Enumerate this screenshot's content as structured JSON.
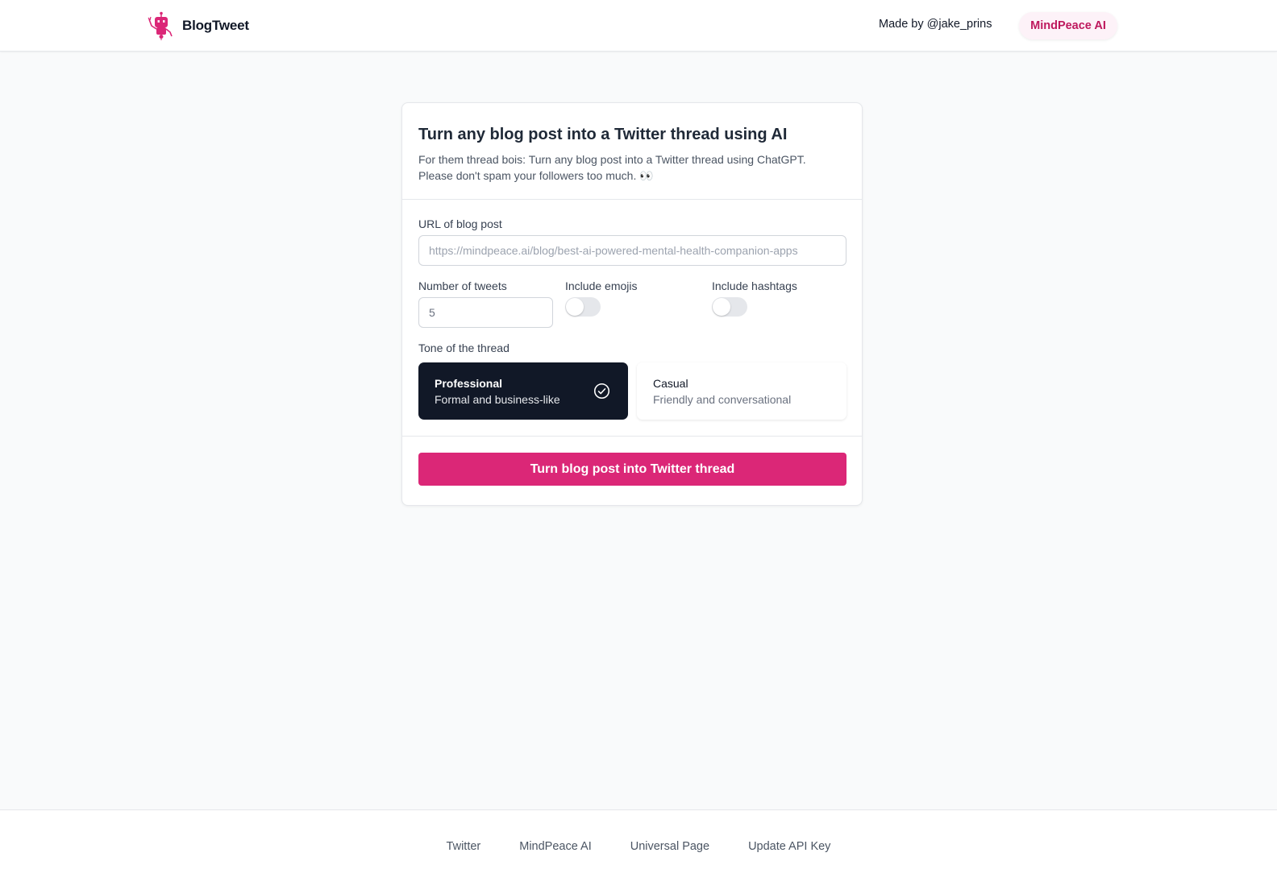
{
  "header": {
    "brand_name": "BlogTweet",
    "logo_icon": "robot-icon",
    "made_by": "Made by @jake_prins",
    "cta_label": "MindPeace AI"
  },
  "card": {
    "title": "Turn any blog post into a Twitter thread using AI",
    "subtitle_line1": "For them thread bois: Turn any blog post into a Twitter thread using ChatGPT.",
    "subtitle_line2": "Please don't spam your followers too much. 👀",
    "url": {
      "label": "URL of blog post",
      "value": "",
      "placeholder": "https://mindpeace.ai/blog/best-ai-powered-mental-health-companion-apps"
    },
    "tweets": {
      "label": "Number of tweets",
      "value": "5"
    },
    "emojis": {
      "label": "Include emojis",
      "enabled": false
    },
    "hashtags": {
      "label": "Include hashtags",
      "enabled": false
    },
    "tone": {
      "label": "Tone of the thread",
      "selected": "Professional",
      "options": [
        {
          "title": "Professional",
          "description": "Formal and business-like",
          "selected": true,
          "icon": "check-circle-icon"
        },
        {
          "title": "Casual",
          "description": "Friendly and conversational",
          "selected": false
        }
      ]
    },
    "submit_label": "Turn blog post into Twitter thread"
  },
  "footer": {
    "links": [
      "Twitter",
      "MindPeace AI",
      "Universal Page",
      "Update API Key"
    ]
  },
  "colors": {
    "accent": "#db2777",
    "pill_bg": "#fdf2f8",
    "pill_text": "#be185d",
    "selected_tone_bg": "#111827",
    "page_bg": "#f9fafb"
  }
}
